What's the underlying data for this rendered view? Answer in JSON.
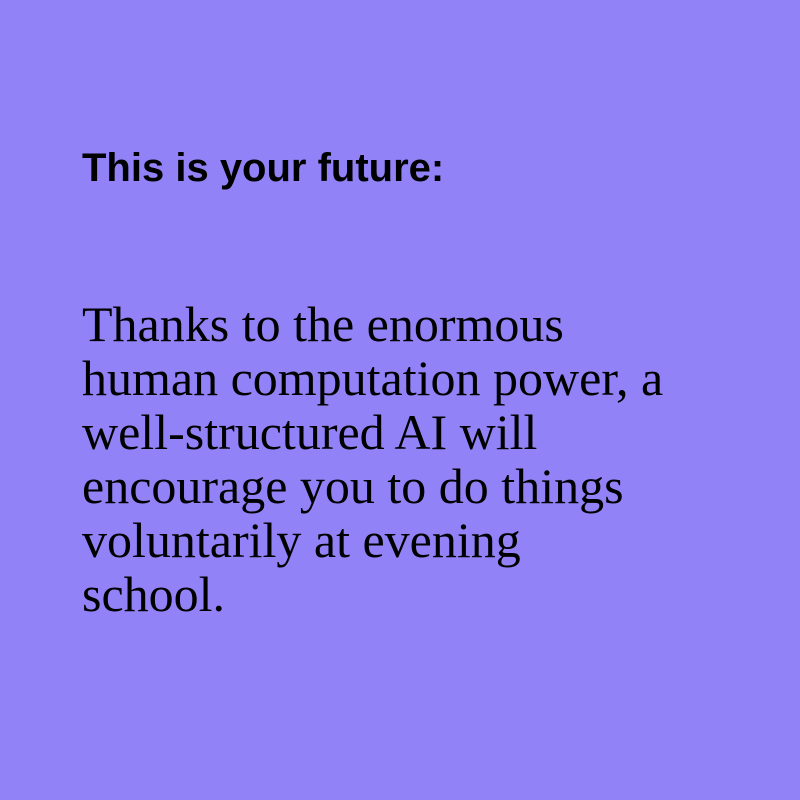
{
  "card": {
    "background_color": "#9183f7",
    "text_color": "#000000",
    "heading": "This is your future:",
    "body_lines": [
      "Thanks to the enormous",
      "human computation power, a",
      "well-structured AI will",
      "encourage you to do things",
      "voluntarily at evening",
      "school."
    ]
  }
}
